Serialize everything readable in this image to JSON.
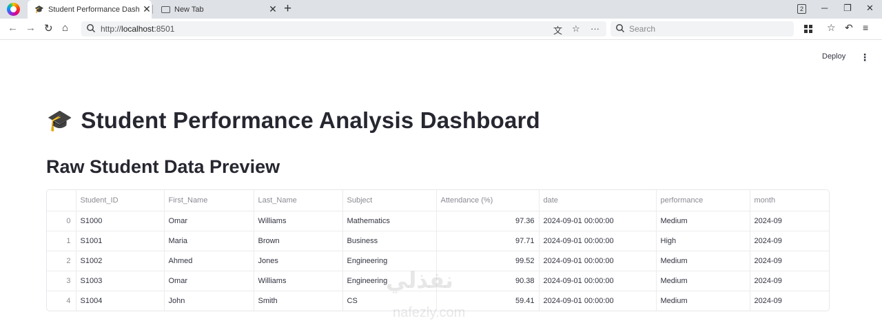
{
  "browser": {
    "tabs": [
      {
        "title": "Student Performance Dashbo",
        "active": true
      },
      {
        "title": "New Tab",
        "active": false
      }
    ],
    "tab_count": "2",
    "url_scheme": "http://",
    "url_host": "localhost",
    "url_port": ":8501",
    "search_placeholder": "Search"
  },
  "app": {
    "deploy_label": "Deploy",
    "menu_icon": "⋮",
    "title_emoji": "🎓",
    "title": "Student Performance Analysis Dashboard",
    "section_title": "Raw Student Data Preview"
  },
  "table": {
    "columns": [
      "",
      "Student_ID",
      "First_Name",
      "Last_Name",
      "Subject",
      "Attendance (%)",
      "date",
      "performance",
      "month"
    ],
    "rows": [
      [
        "0",
        "S1000",
        "Omar",
        "Williams",
        "Mathematics",
        "97.36",
        "2024-09-01 00:00:00",
        "Medium",
        "2024-09"
      ],
      [
        "1",
        "S1001",
        "Maria",
        "Brown",
        "Business",
        "97.71",
        "2024-09-01 00:00:00",
        "High",
        "2024-09"
      ],
      [
        "2",
        "S1002",
        "Ahmed",
        "Jones",
        "Engineering",
        "99.52",
        "2024-09-01 00:00:00",
        "Medium",
        "2024-09"
      ],
      [
        "3",
        "S1003",
        "Omar",
        "Williams",
        "Engineering",
        "90.38",
        "2024-09-01 00:00:00",
        "Medium",
        "2024-09"
      ],
      [
        "4",
        "S1004",
        "John",
        "Smith",
        "CS",
        "59.41",
        "2024-09-01 00:00:00",
        "Medium",
        "2024-09"
      ]
    ]
  },
  "watermark": {
    "main": "نفذلي",
    "sub": "nafezly.com"
  }
}
